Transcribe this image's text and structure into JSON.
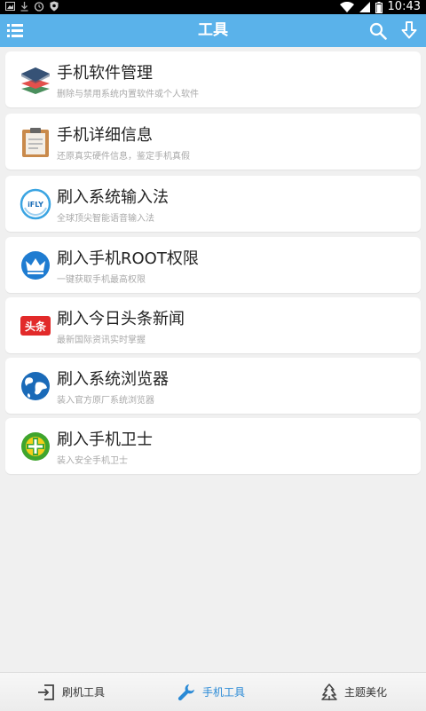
{
  "statusbar": {
    "time": "10:43"
  },
  "header": {
    "title": "工具"
  },
  "tools": [
    {
      "title": "手机软件管理",
      "subtitle": "删除与禁用系统内置软件或个人软件",
      "icon": "layers-icon"
    },
    {
      "title": "手机详细信息",
      "subtitle": "还原真实硬件信息，鉴定手机真假",
      "icon": "clipboard-icon"
    },
    {
      "title": "刷入系统输入法",
      "subtitle": "全球顶尖智能语音输入法",
      "icon": "ifly-logo-icon"
    },
    {
      "title": "刷入手机ROOT权限",
      "subtitle": "一键获取手机最高权限",
      "icon": "crown-icon"
    },
    {
      "title": "刷入今日头条新闻",
      "subtitle": "最新国际资讯实时掌握",
      "icon": "toutiao-logo-icon"
    },
    {
      "title": "刷入系统浏览器",
      "subtitle": "装入官方原厂系统浏览器",
      "icon": "globe-icon"
    },
    {
      "title": "刷入手机卫士",
      "subtitle": "装入安全手机卫士",
      "icon": "security-shield-icon"
    }
  ],
  "tabs": [
    {
      "label": "刷机工具",
      "icon": "flash-enter-icon",
      "active": false
    },
    {
      "label": "手机工具",
      "icon": "wrench-icon",
      "active": true
    },
    {
      "label": "主题美化",
      "icon": "tree-icon",
      "active": false
    }
  ],
  "colors": {
    "header": "#5ab2ea",
    "active_tab": "#2a8ad6"
  }
}
